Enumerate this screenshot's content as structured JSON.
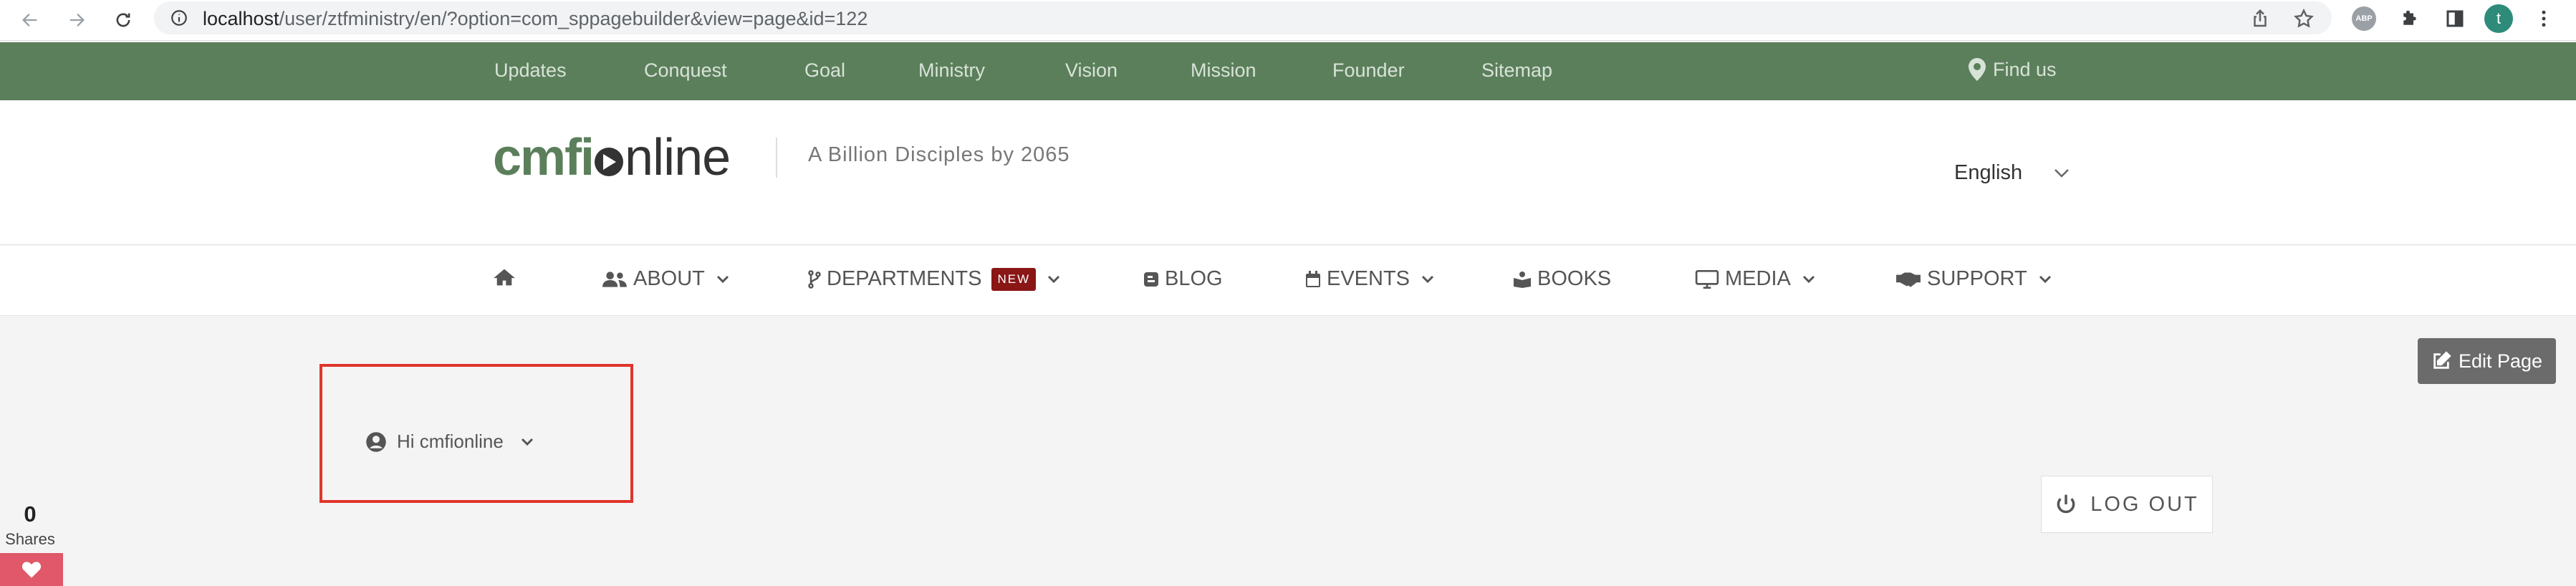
{
  "browser": {
    "url_host": "localhost",
    "url_path": "/user/ztfministry/en/?option=com_sppagebuilder&view=page&id=122",
    "ext_abp": "ABP",
    "profile_initial": "t"
  },
  "topbar": {
    "links": [
      "Updates",
      "Conquest",
      "Goal",
      "Ministry",
      "Vision",
      "Mission",
      "Founder",
      "Sitemap"
    ],
    "find_us": "Find us"
  },
  "header": {
    "logo_part1": "cmfi",
    "logo_part2": "nline",
    "tagline": "A Billion Disciples by 2065",
    "language": "English"
  },
  "menu": {
    "about": "ABOUT",
    "departments": "DEPARTMENTS",
    "new_badge": "NEW",
    "blog": "BLOG",
    "events": "EVENTS",
    "books": "BOOKS",
    "media": "MEDIA",
    "support": "SUPPORT"
  },
  "content": {
    "edit_page": "Edit Page",
    "greeting": "Hi cmfionline",
    "logout": "LOG OUT"
  },
  "social": {
    "share_count": "0",
    "share_label": "Shares"
  },
  "colors": {
    "topbar": "#5b7f5b",
    "badge": "#8a1616",
    "highlight": "#e0352b",
    "heart": "#e0586a"
  }
}
